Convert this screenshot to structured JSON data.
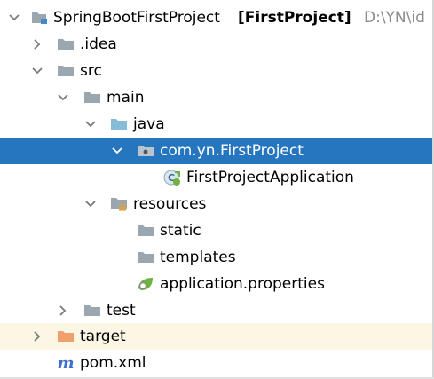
{
  "project": {
    "name": "SpringBootFirstProject",
    "module": "[FirstProject]",
    "path": "D:\\YN\\id"
  },
  "tree": {
    "idea": ".idea",
    "src": "src",
    "main": "main",
    "java": "java",
    "package": "com.yn.FirstProject",
    "app_class": "FirstProjectApplication",
    "resources": "resources",
    "static": "static",
    "templates": "templates",
    "properties": "application.properties",
    "test": "test",
    "target": "target",
    "pom": "pom.xml"
  },
  "colors": {
    "selection": "#2675bf",
    "folder": "#9aa7b0",
    "source_folder": "#87bcd9",
    "excluded_folder": "#f0a16b",
    "spring_green": "#6db33f",
    "maven_blue": "#3d6fd1"
  },
  "icons": {
    "folder": "folder-icon",
    "module": "module-folder-icon",
    "source": "source-folder-icon",
    "package": "package-icon",
    "class": "spring-boot-class-icon",
    "resources": "resources-folder-icon",
    "properties": "spring-properties-icon",
    "excluded": "excluded-folder-icon",
    "maven": "maven-icon"
  }
}
